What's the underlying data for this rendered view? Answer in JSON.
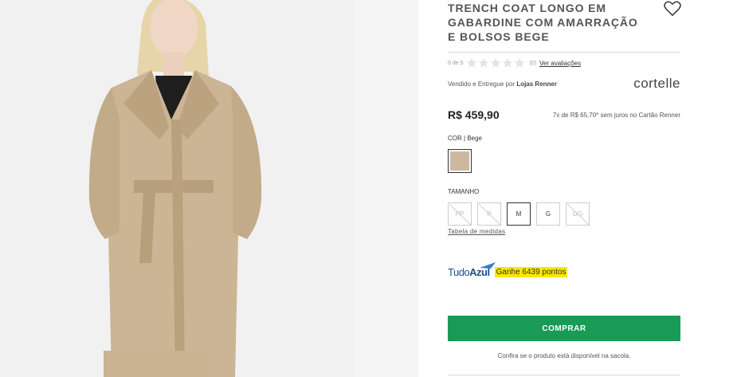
{
  "product": {
    "title": "TRENCH COAT LONGO EM GABARDINE COM AMARRAÇÃO E BOLSOS BEGE",
    "rating_prefix": "0 de 5",
    "rating_count": "(0)",
    "see_reviews": "Ver avaliações",
    "seller_prefix": "Vendido e Entregue por",
    "seller_name": "Lojas Renner",
    "brand": "cortelle",
    "price": "R$ 459,90",
    "installments": "7x de R$ 65,70* sem juros no Cartão Renner"
  },
  "color": {
    "label": "COR",
    "value": "| Bege",
    "swatch_hex": "#cdb89f"
  },
  "size": {
    "label": "TAMANHO",
    "options": [
      "PP",
      "P",
      "M",
      "G",
      "GG"
    ],
    "selected": "M",
    "unavailable": [
      "PP",
      "P",
      "GG"
    ],
    "table_link": "Tabela de medidas"
  },
  "loyalty": {
    "logo_light": "Tudo",
    "logo_bold": "Azul",
    "points_text": "Ganhe 6439 pontos"
  },
  "actions": {
    "buy_label": "COMPRAR",
    "availability_notice": "Confira se o produto está disponível na sacola."
  },
  "colors": {
    "buy_button": "#1a9b55",
    "highlight": "#ffe600",
    "azul_blue": "#1d4e8f"
  }
}
